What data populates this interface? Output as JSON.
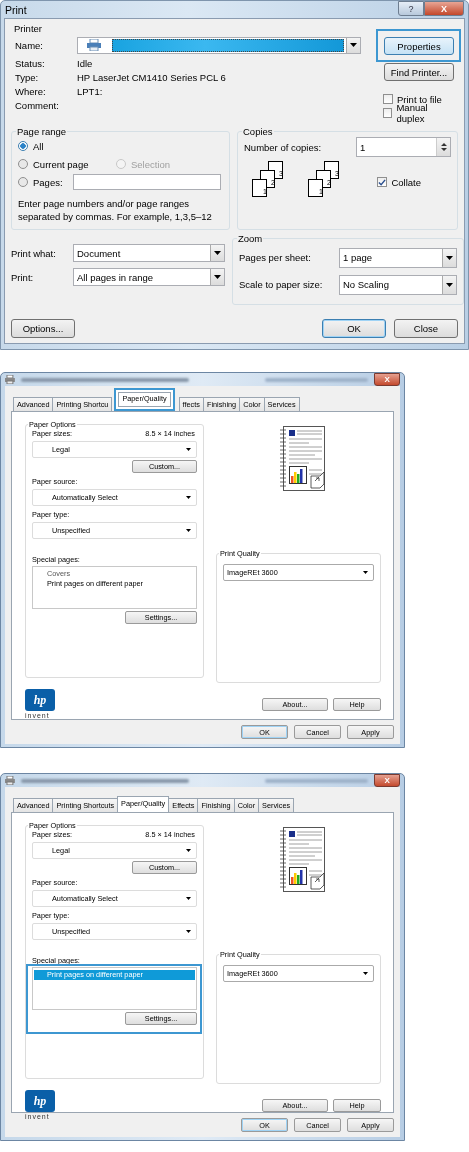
{
  "print_dialog": {
    "title": "Print",
    "help_button": "?",
    "close_button": "X",
    "printer": {
      "legend": "Printer",
      "name_label": "Name:",
      "info": [
        {
          "label": "Status:",
          "value": "Idle"
        },
        {
          "label": "Type:",
          "value": "HP LaserJet CM1410 Series PCL 6"
        },
        {
          "label": "Where:",
          "value": "LPT1:"
        },
        {
          "label": "Comment:"
        }
      ],
      "properties_button": {
        "label": "Properties",
        "highlighted": true
      },
      "find_printer_button": "Find Printer...",
      "options": [
        {
          "label": "Print to file",
          "checked": false
        },
        {
          "label": "Manual duplex",
          "checked": false
        }
      ]
    },
    "page_range": {
      "legend": "Page range",
      "choices": [
        {
          "label": "All",
          "selected": true,
          "disabled": false
        },
        {
          "label": "Current page",
          "selected": false,
          "disabled": false
        },
        {
          "label": "Selection",
          "selected": false,
          "disabled": true
        },
        {
          "label": "Pages:",
          "selected": false,
          "disabled": false
        }
      ],
      "hint": "Enter page numbers and/or page ranges\nseparated by commas.  For example, 1,3,5–12"
    },
    "copies": {
      "legend": "Copies",
      "label": "Number of copies:",
      "value": "1",
      "stacks": [
        [
          "3",
          "2",
          "1"
        ],
        [
          "3",
          "2",
          "1"
        ]
      ],
      "collate": {
        "label": "Collate",
        "checked": true
      }
    },
    "print_what": {
      "label": "Print what:",
      "value": "Document"
    },
    "print": {
      "label": "Print:",
      "value": "All pages in range"
    },
    "zoom": {
      "legend": "Zoom",
      "rows": [
        {
          "label": "Pages per sheet:",
          "value": "1 page"
        },
        {
          "label": "Scale to paper size:",
          "value": "No Scaling"
        }
      ]
    },
    "buttons": {
      "options": "Options...",
      "ok": "OK",
      "close": "Close"
    }
  },
  "properties_dialogs": [
    {
      "close_button": "X",
      "tabs": [
        {
          "label": "Advanced",
          "selected": false,
          "highlighted": false
        },
        {
          "label": "Printing Shortcu",
          "selected": false,
          "highlighted": false
        },
        {
          "label": "Paper/Quality",
          "selected": true,
          "highlighted": true
        },
        {
          "label": "ffects",
          "selected": false,
          "highlighted": false
        },
        {
          "label": "Finishing",
          "selected": false,
          "highlighted": false
        },
        {
          "label": "Color",
          "selected": false,
          "highlighted": false
        },
        {
          "label": "Services",
          "selected": false,
          "highlighted": false
        }
      ],
      "paper_options": {
        "legend": "Paper Options",
        "sizes_label": "Paper sizes:",
        "size_text": "8.5 × 14 inches",
        "size_value": "Legal",
        "custom_button": "Custom...",
        "source_label": "Paper source:",
        "source_value": "Automatically Select",
        "type_label": "Paper type:",
        "type_value": "Unspecified"
      },
      "special_pages": {
        "label": "Special pages:",
        "highlighted": false,
        "items": [
          {
            "label": "Covers",
            "selected": false
          },
          {
            "label": "Print pages on different paper",
            "selected": false
          }
        ],
        "settings_button": "Settings..."
      },
      "print_quality": {
        "legend": "Print Quality",
        "value": "ImageREt 3600"
      },
      "logo": {
        "mark": "hp",
        "tagline": "invent"
      },
      "buttons": {
        "about": "About...",
        "help": "Help",
        "ok": "OK",
        "cancel": "Cancel",
        "apply": "Apply"
      }
    },
    {
      "close_button": "X",
      "tabs": [
        {
          "label": "Advanced",
          "selected": false,
          "highlighted": false
        },
        {
          "label": "Printing Shortcuts",
          "selected": false,
          "highlighted": false
        },
        {
          "label": "Paper/Quality",
          "selected": true,
          "highlighted": false
        },
        {
          "label": "Effects",
          "selected": false,
          "highlighted": false
        },
        {
          "label": "Finishing",
          "selected": false,
          "highlighted": false
        },
        {
          "label": "Color",
          "selected": false,
          "highlighted": false
        },
        {
          "label": "Services",
          "selected": false,
          "highlighted": false
        }
      ],
      "paper_options": {
        "legend": "Paper Options",
        "sizes_label": "Paper sizes:",
        "size_text": "8.5 × 14 inches",
        "size_value": "Legal",
        "custom_button": "Custom...",
        "source_label": "Paper source:",
        "source_value": "Automatically Select",
        "type_label": "Paper type:",
        "type_value": "Unspecified"
      },
      "special_pages": {
        "label": "Special pages:",
        "highlighted": true,
        "items": [
          {
            "label": "Print pages on different paper",
            "selected": true
          }
        ],
        "settings_button": "Settings..."
      },
      "print_quality": {
        "legend": "Print Quality",
        "value": "ImageREt 3600"
      },
      "logo": {
        "mark": "hp",
        "tagline": "invent"
      },
      "buttons": {
        "about": "About...",
        "help": "Help",
        "ok": "OK",
        "cancel": "Cancel",
        "apply": "Apply"
      }
    }
  ]
}
